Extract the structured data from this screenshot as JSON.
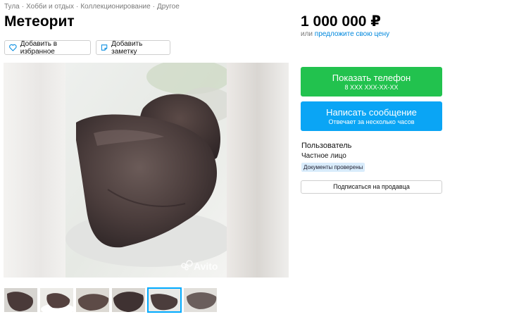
{
  "breadcrumbs": [
    {
      "label": "Тула"
    },
    {
      "label": "Хобби и отдых"
    },
    {
      "label": "Коллекционирование"
    },
    {
      "label": "Другое"
    }
  ],
  "breadcrumb_separator": "·",
  "listing": {
    "title": "Метеорит",
    "favorite_label": "Добавить в избранное",
    "note_label": "Добавить заметку"
  },
  "price": {
    "value": "1 000 000 ₽",
    "offer_prefix": "или",
    "offer_link": "предложите свою цену"
  },
  "contact": {
    "phone_label": "Показать телефон",
    "phone_masked": "8 XXX XXX-XX-XX",
    "message_label": "Написать сообщение",
    "message_sub": "Отвечает за несколько часов"
  },
  "seller": {
    "name": "Пользователь",
    "type": "Частное лицо",
    "badge": "Документы проверены",
    "subscribe_label": "Подписаться на продавца"
  },
  "gallery": {
    "watermark": "Avito",
    "thumbnail_count": 6,
    "active_thumbnail": 5
  },
  "colors": {
    "green_button": "#22c24e",
    "blue_button": "#0aa5f5",
    "link": "#0088dd",
    "badge_bg": "#d9ecfb"
  }
}
